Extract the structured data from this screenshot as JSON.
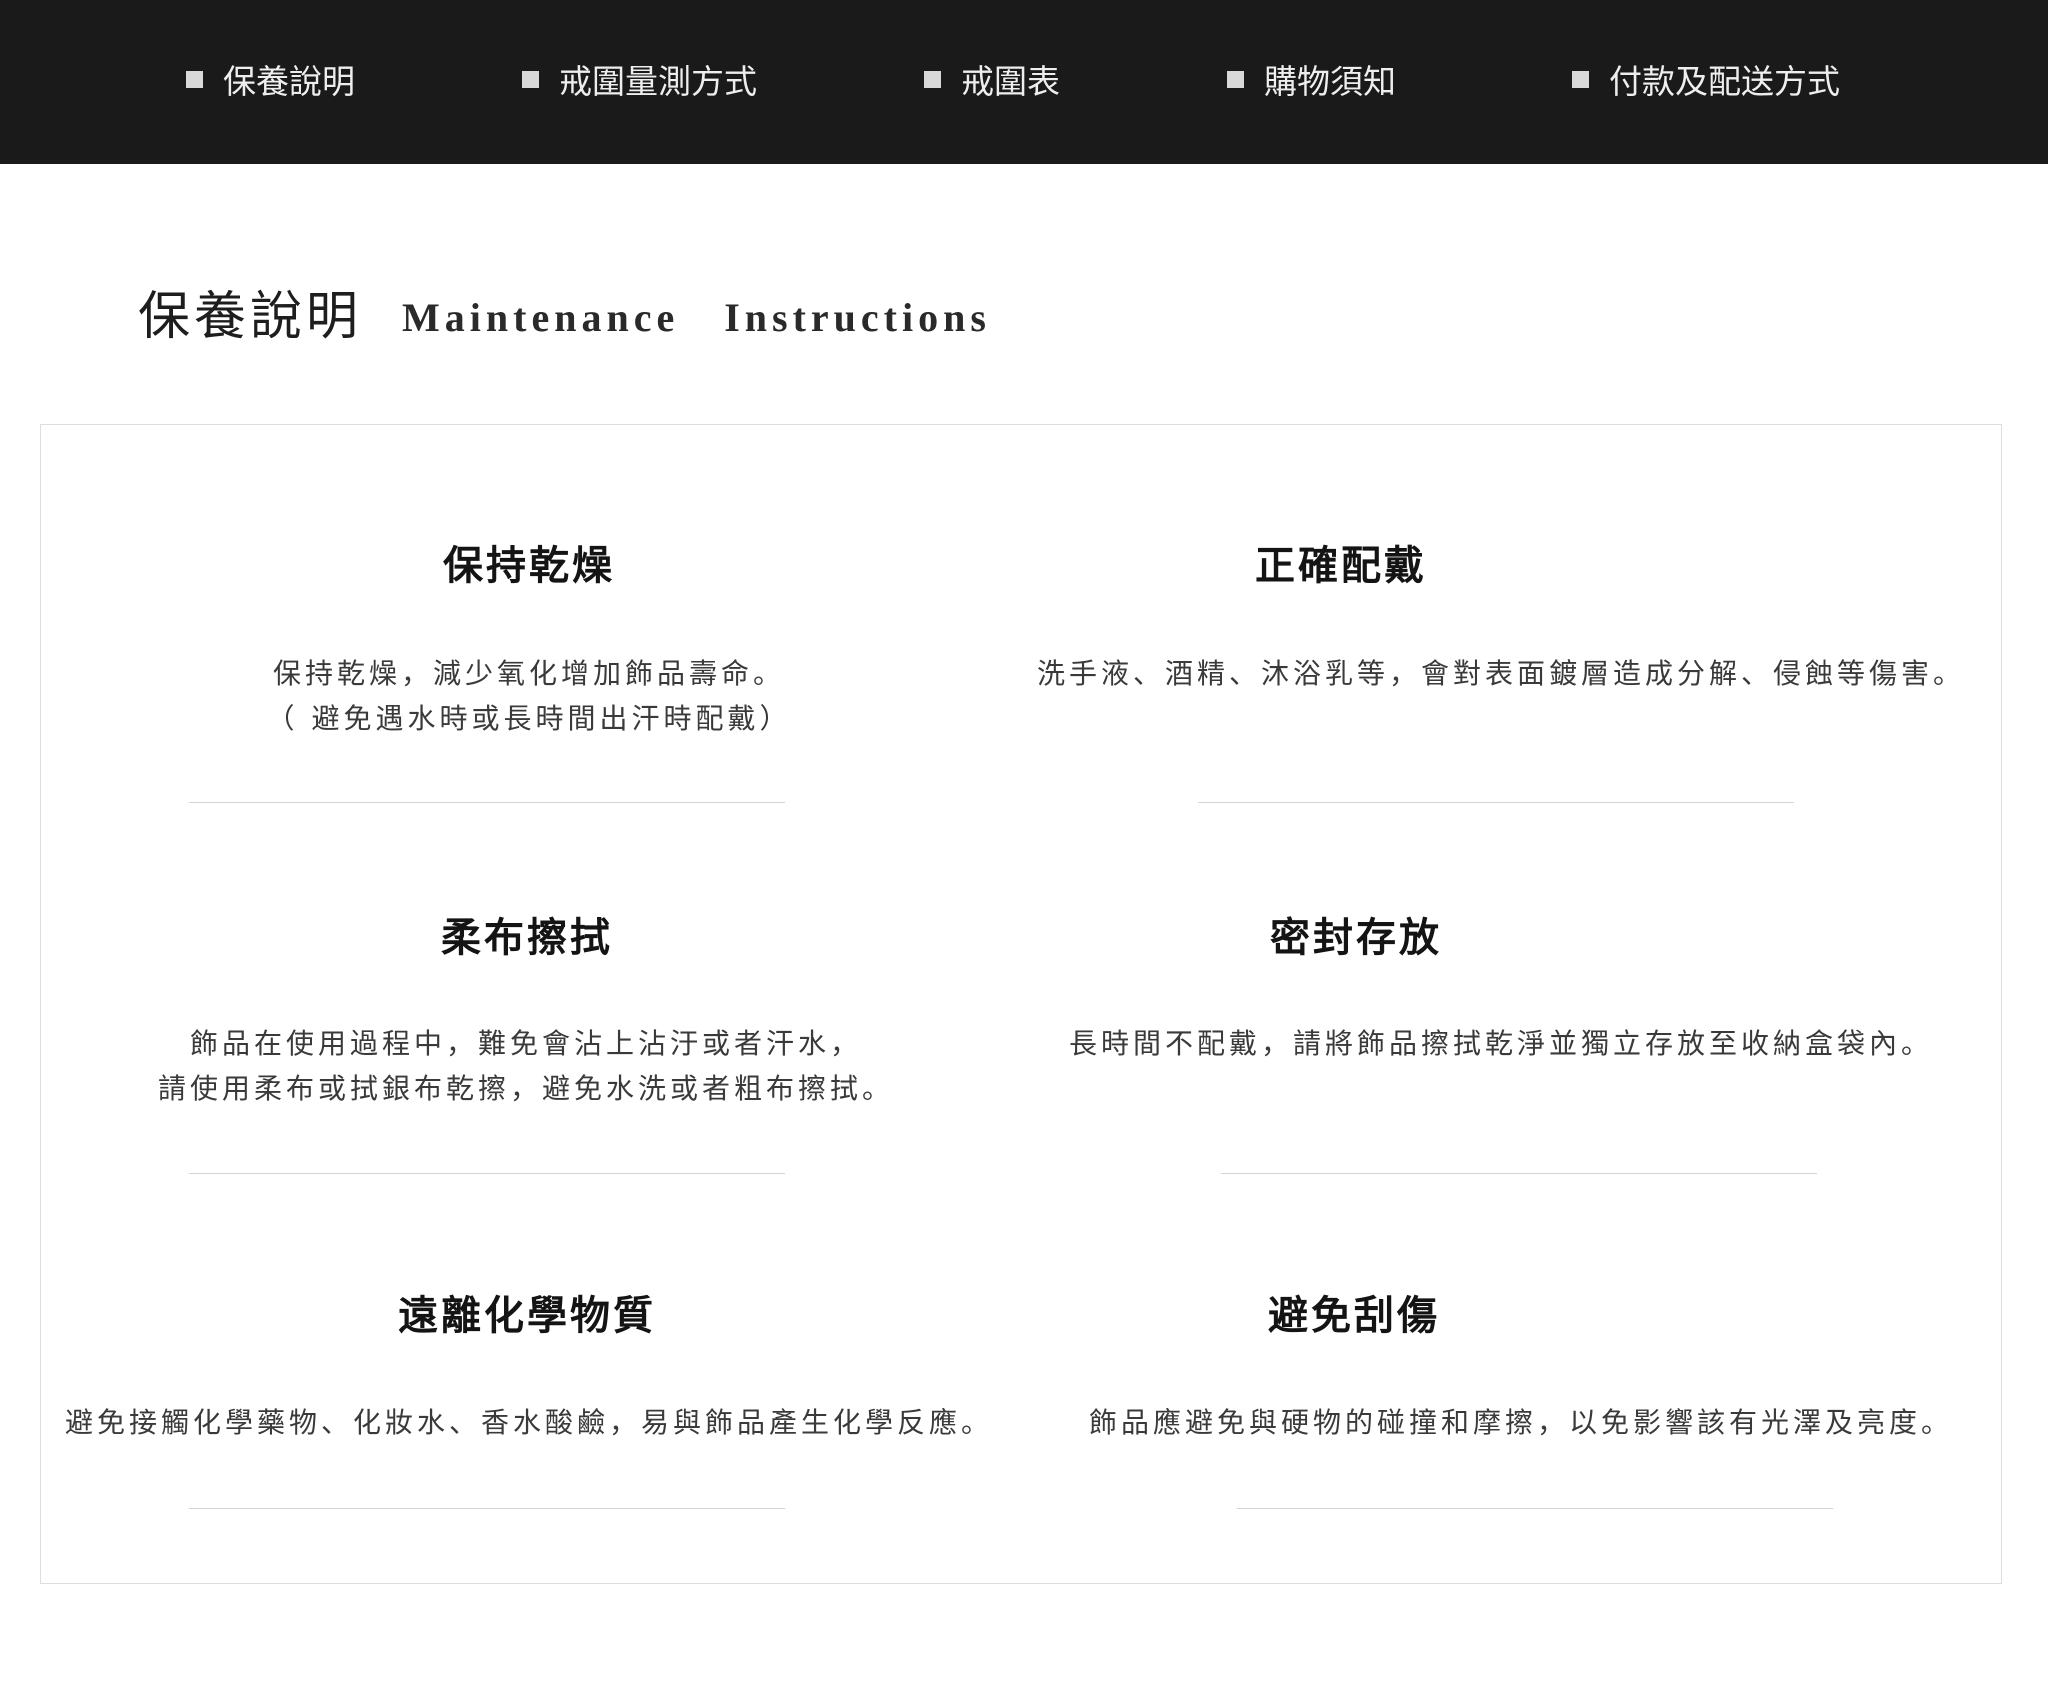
{
  "nav": {
    "items": [
      {
        "label": "保養說明"
      },
      {
        "label": "戒圍量測方式"
      },
      {
        "label": "戒圍表"
      },
      {
        "label": "購物須知"
      },
      {
        "label": "付款及配送方式"
      }
    ]
  },
  "title": {
    "zh": "保養說明",
    "en": "Maintenance Instructions"
  },
  "sections": [
    {
      "heading": "保持乾燥",
      "lines": [
        "保持乾燥，減少氧化增加飾品壽命。",
        "（ 避免遇水時或長時間出汗時配戴）"
      ]
    },
    {
      "heading": "正確配戴",
      "lines": [
        "洗手液、酒精、沐浴乳等，會對表面鍍層造成分解、侵蝕等傷害。"
      ]
    },
    {
      "heading": "柔布擦拭",
      "lines": [
        "飾品在使用過程中，難免會沾上沾汙或者汗水，",
        "請使用柔布或拭銀布乾擦，避免水洗或者粗布擦拭。"
      ]
    },
    {
      "heading": "密封存放",
      "lines": [
        "長時間不配戴，請將飾品擦拭乾淨並獨立存放至收納盒袋內。"
      ]
    },
    {
      "heading": "遠離化學物質",
      "lines": [
        "避免接觸化學藥物、化妝水、香水酸鹼，易與飾品產生化學反應。"
      ]
    },
    {
      "heading": "避免刮傷",
      "lines": [
        "飾品應避免與硬物的碰撞和摩擦，以免影響該有光澤及亮度。"
      ]
    }
  ],
  "colors": {
    "nav_background": "#1a1a1a",
    "nav_text": "#eeeeee",
    "panel_border": "#dedede",
    "divider": "#d4d4d4"
  }
}
